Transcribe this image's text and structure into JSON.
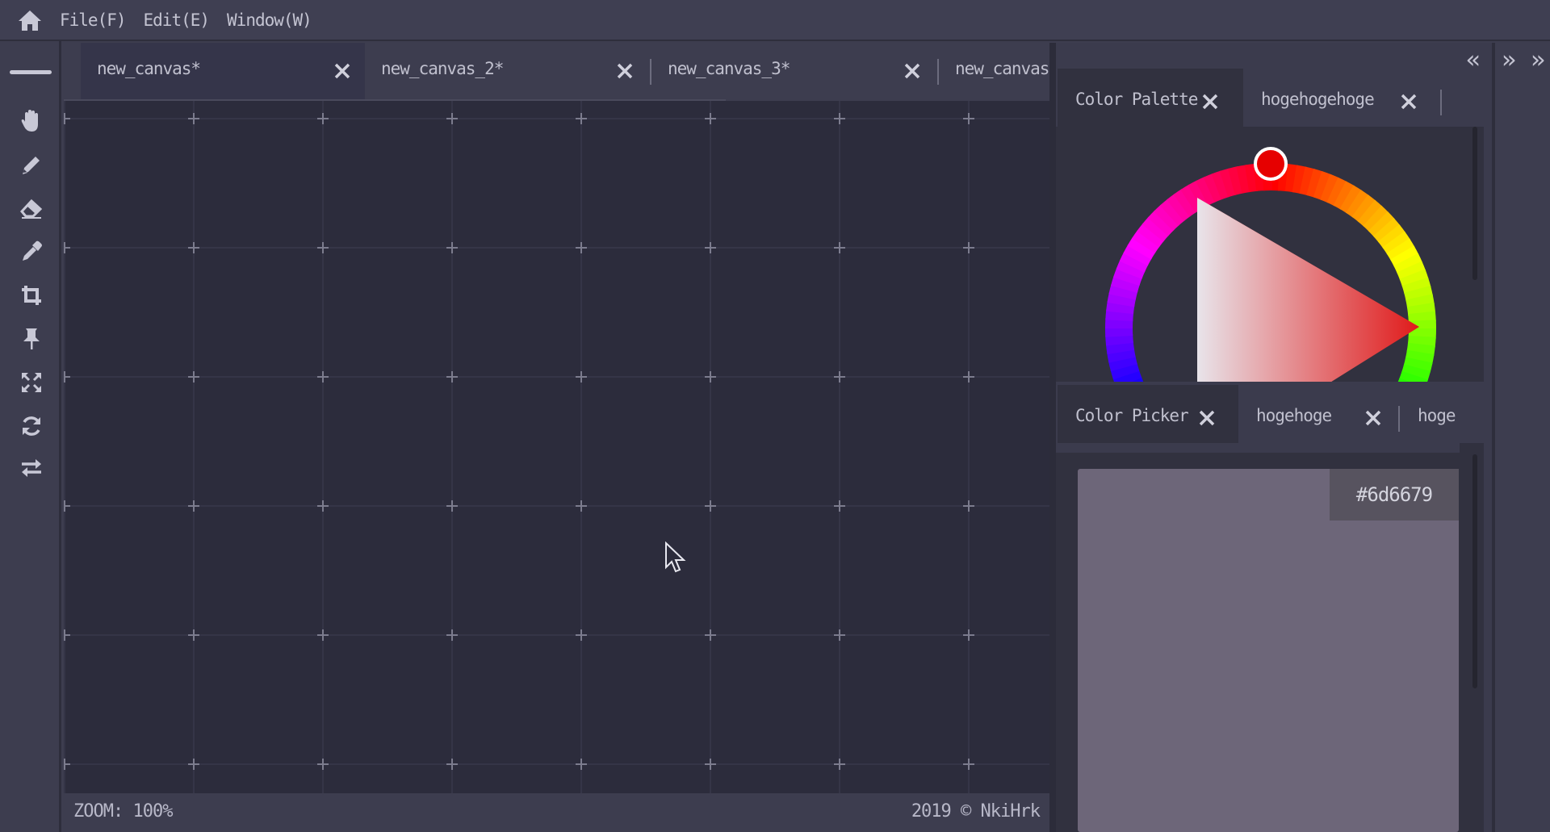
{
  "menubar": {
    "items": [
      "File(F)",
      "Edit(E)",
      "Window(W)"
    ]
  },
  "canvas_tabs": [
    {
      "label": "new_canvas*",
      "active": true
    },
    {
      "label": "new_canvas_2*",
      "active": false
    },
    {
      "label": "new_canvas_3*",
      "active": false
    },
    {
      "label": "new_canvas",
      "active": false
    }
  ],
  "tools": [
    "hand-icon",
    "pencil-icon",
    "eraser-icon",
    "eyedropper-icon",
    "crop-icon",
    "pin-icon",
    "expand-icon",
    "rotate-icon",
    "swap-icon"
  ],
  "status": {
    "zoom": "ZOOM: 100%",
    "copyright": "2019 © NkiHrk"
  },
  "palette_panel": {
    "tabs": [
      "Color Palette",
      "hogehogehoge"
    ]
  },
  "picker_panel": {
    "tabs": [
      "Color Picker",
      "hogehoge",
      "hoge"
    ],
    "hex": "#6d6679"
  },
  "colors": {
    "selected": "#6d6679",
    "selected_hue": "#ff0000",
    "accent_text": "#c0c0ce",
    "canvas_bg": "#2c2c3c"
  }
}
